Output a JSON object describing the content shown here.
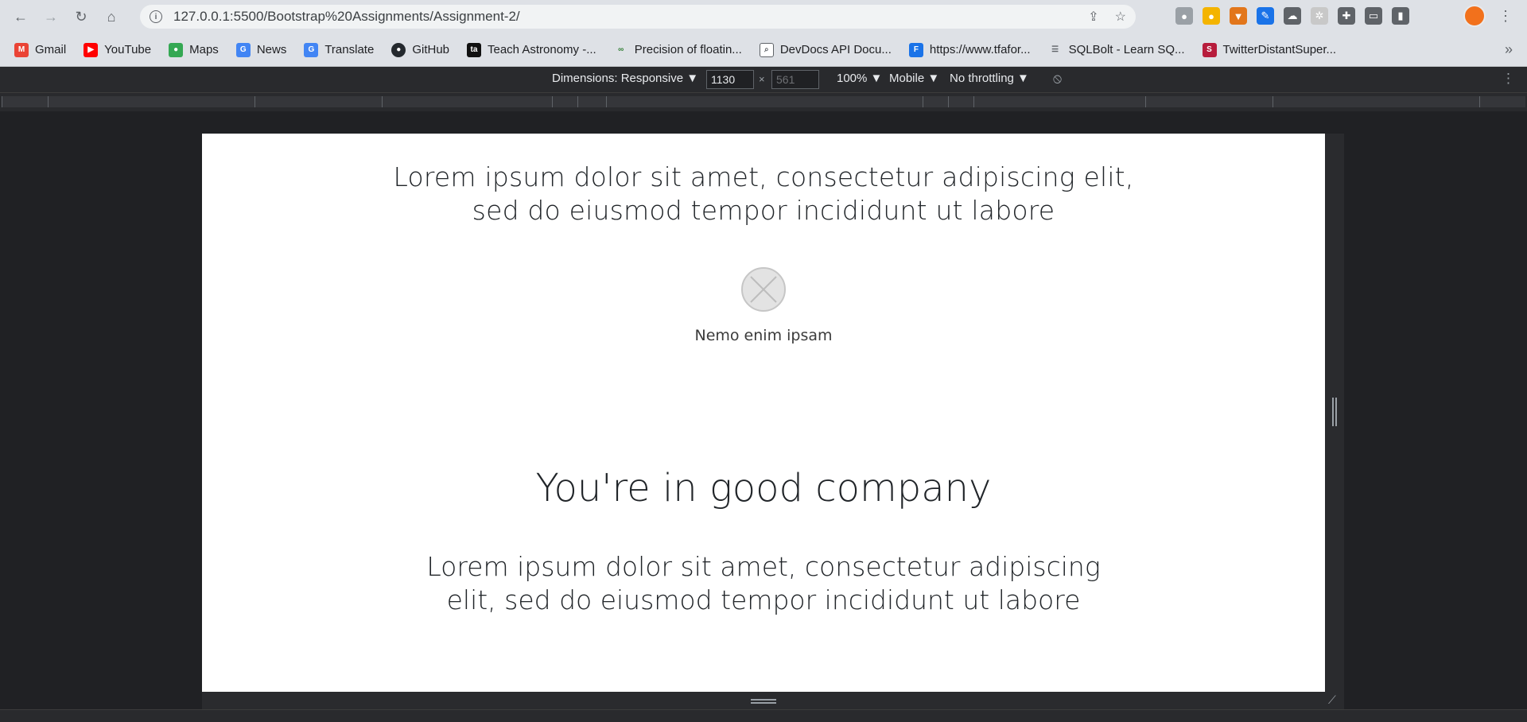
{
  "browser": {
    "url": "127.0.0.1:5500/Bootstrap%20Assignments/Assignment-2/",
    "bookmarks": [
      {
        "label": "Gmail",
        "color": "#ea4335"
      },
      {
        "label": "YouTube",
        "color": "#ff0000"
      },
      {
        "label": "Maps",
        "color": "#34a853"
      },
      {
        "label": "News",
        "color": "#4285f4"
      },
      {
        "label": "Translate",
        "color": "#4285f4"
      },
      {
        "label": "GitHub",
        "color": "#24292e"
      },
      {
        "label": "Teach Astronomy -...",
        "color": "#111111"
      },
      {
        "label": "Precision of floatin...",
        "color": "#2e7d32"
      },
      {
        "label": "DevDocs API Docu...",
        "color": "#5f6368"
      },
      {
        "label": "https://www.tfafor...",
        "color": "#1a73e8"
      },
      {
        "label": "SQLBolt - Learn SQ...",
        "color": "#5f6368"
      },
      {
        "label": "TwitterDistantSuper...",
        "color": "#b71c3c"
      }
    ]
  },
  "devtools": {
    "dimensions_label": "Dimensions: Responsive ▼",
    "width": "1130",
    "height": "561",
    "times": "×",
    "zoom": "100% ▼",
    "device": "Mobile ▼",
    "throttling": "No throttling ▼"
  },
  "page": {
    "lead1_line1": "Lorem ipsum dolor sit amet, consectetur adipiscing elit,",
    "lead1_line2": "sed do eiusmod tempor incididunt ut labore",
    "caption": "Nemo enim ipsam",
    "heading": "You're in good company",
    "lead2_line1": "Lorem ipsum dolor sit amet, consectetur adipiscing",
    "lead2_line2": "elit, sed do eiusmod tempor incididunt ut labore"
  }
}
